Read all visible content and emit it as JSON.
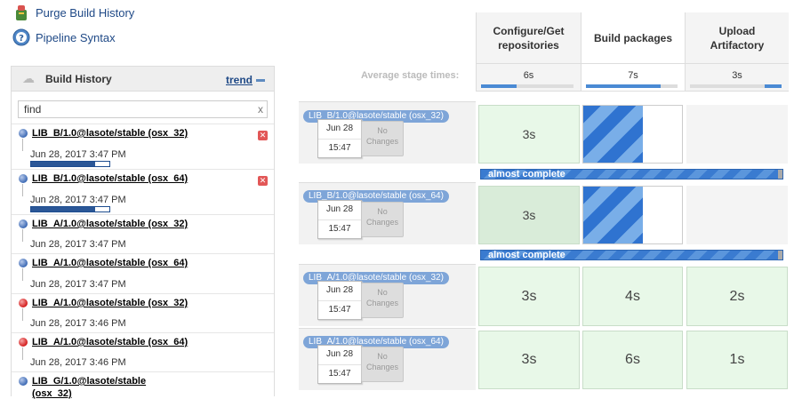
{
  "tasks": {
    "purge_label": "Purge Build History",
    "pipeline_label": "Pipeline Syntax"
  },
  "build_history": {
    "title": "Build History",
    "trend_label": "trend",
    "find_value": "find",
    "find_clear": "x",
    "builds": [
      {
        "name": "LIB_B/1.0@lasote/stable (osx_32)",
        "date": "Jun 28, 2017 3:47 PM",
        "status": "running",
        "progress": 0.82
      },
      {
        "name": "LIB_B/1.0@lasote/stable (osx_64)",
        "date": "Jun 28, 2017 3:47 PM",
        "status": "running",
        "progress": 0.82
      },
      {
        "name": "LIB_A/1.0@lasote/stable (osx_32)",
        "date": "Jun 28, 2017 3:47 PM",
        "status": "success"
      },
      {
        "name": "LIB_A/1.0@lasote/stable (osx_64)",
        "date": "Jun 28, 2017 3:47 PM",
        "status": "success"
      },
      {
        "name": "LIB_A/1.0@lasote/stable (osx_32)",
        "date": "Jun 28, 2017 3:46 PM",
        "status": "failed"
      },
      {
        "name": "LIB_A/1.0@lasote/stable (osx_64)",
        "date": "Jun 28, 2017 3:46 PM",
        "status": "failed"
      },
      {
        "name_line1": "LIB_G/1.0@lasote/stable",
        "name_line2": "(osx_32)",
        "status": "success"
      }
    ]
  },
  "stage_view": {
    "avg_label": "Average stage times:",
    "stages": [
      {
        "name_line1": "Configure/Get",
        "name_line2": "repositories",
        "avg": "6s",
        "avg_fraction": 0.38
      },
      {
        "name_line1": "Build packages",
        "name_line2": "",
        "avg": "7s",
        "avg_fraction": 0.82
      },
      {
        "name_line1": "Upload",
        "name_line2": "Artifactory",
        "avg": "3s",
        "avg_fraction": 0.18
      }
    ],
    "runs": [
      {
        "job": "LIB_B/1.0@lasote/stable (osx_32)",
        "date": "Jun 28",
        "time": "15:47",
        "changes_line1": "No",
        "changes_line2": "Changes",
        "cells": [
          "3s",
          "",
          ""
        ],
        "status_text": "almost complete"
      },
      {
        "job": "LIB_B/1.0@lasote/stable (osx_64)",
        "date": "Jun 28",
        "time": "15:47",
        "changes_line1": "No",
        "changes_line2": "Changes",
        "cells": [
          "3s",
          "",
          ""
        ],
        "status_text": "almost complete"
      },
      {
        "job": "LIB_A/1.0@lasote/stable (osx_32)",
        "date": "Jun 28",
        "time": "15:47",
        "changes_line1": "No",
        "changes_line2": "Changes",
        "cells": [
          "3s",
          "4s",
          "2s"
        ]
      },
      {
        "job": "LIB_A/1.0@lasote/stable (osx_64)",
        "date": "Jun 28",
        "time": "15:47",
        "changes_line1": "No",
        "changes_line2": "Changes",
        "cells": [
          "3s",
          "6s",
          "1s"
        ]
      }
    ]
  },
  "colors": {
    "link": "#204a87",
    "success_cell": "#e8f8e8",
    "progress_blue": "#2f73d0",
    "failed_red": "#d41d1d"
  }
}
